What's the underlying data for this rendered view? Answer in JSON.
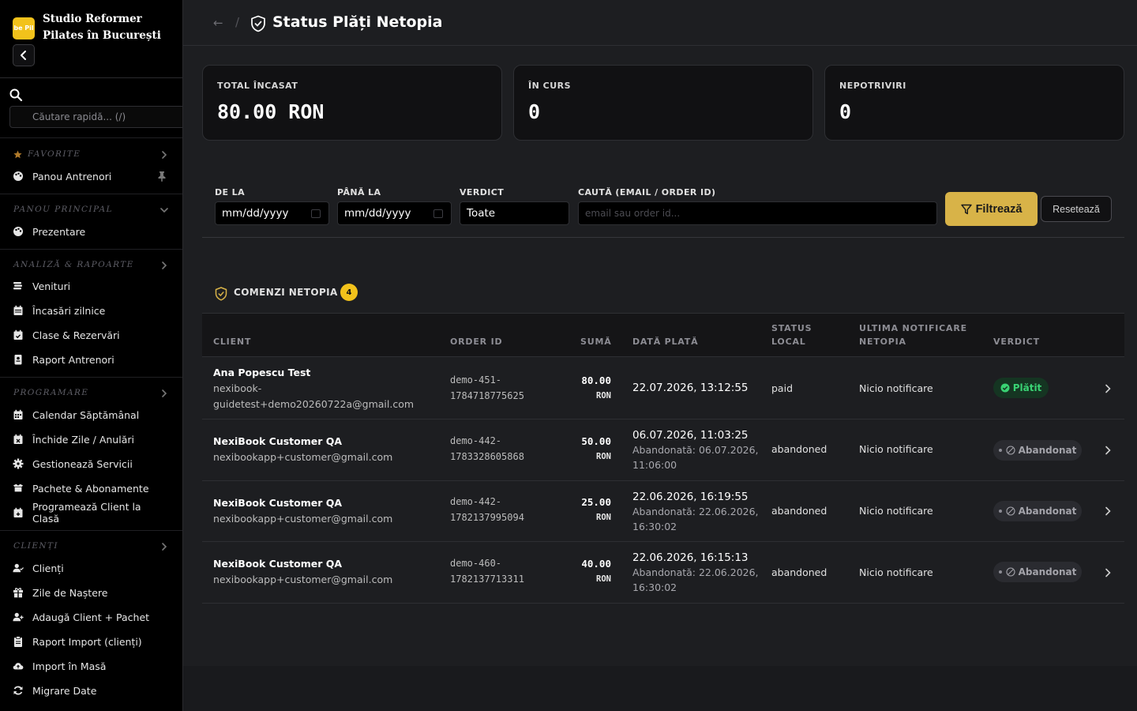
{
  "app": {
    "brand_name": "Studio Reformer Pilates în București",
    "logo_text": "be Pil"
  },
  "sidebar": {
    "search_placeholder": "Căutare rapidă... (/)",
    "sections": {
      "favorite": "FAVORITE",
      "panou_principal": "PANOU PRINCIPAL",
      "analiza": "ANALIZĂ & RAPOARTE",
      "programare": "PROGRAMARE",
      "clienti": "CLIENȚI"
    },
    "items": {
      "panou_antrenori": "Panou Antrenori",
      "prezentare": "Prezentare",
      "venituri": "Venituri",
      "incasari": "Încasări zilnice",
      "clase": "Clase & Rezervări",
      "raport_antrenori": "Raport Antrenori",
      "calendar": "Calendar Săptămânal",
      "inchide_zile": "Închide Zile / Anulări",
      "servicii": "Gestionează Servicii",
      "pachete": "Pachete & Abonamente",
      "programeaza": "Programează Client la Clasă",
      "clienti": "Clienți",
      "zile_nastere": "Zile de Naștere",
      "adauga_client": "Adaugă Client + Pachet",
      "raport_import": "Raport Import (clienți)",
      "import_masa": "Import în Masă",
      "migrare": "Migrare Date"
    }
  },
  "header": {
    "back": "←",
    "separator": "/",
    "title": "Status Plăți Netopia"
  },
  "stats": {
    "total_label": "TOTAL ÎNCASAT",
    "total_value": "80.00 RON",
    "curs_label": "ÎN CURS",
    "curs_value": "0",
    "nepotriviri_label": "NEPOTRIVIRI",
    "nepotriviri_value": "0"
  },
  "filters": {
    "from_label": "DE LA",
    "from_value": "mm/dd/yyyy",
    "to_label": "PÂNĂ LA",
    "to_value": "mm/dd/yyyy",
    "verdict_label": "VERDICT",
    "verdict_value": "Toate",
    "search_label": "CAUTĂ (EMAIL / ORDER ID)",
    "search_placeholder": "email sau order id...",
    "filter_button": "Filtrează",
    "reset_button": "Resetează"
  },
  "orders": {
    "title": "COMENZI NETOPIA",
    "count": "4",
    "columns": {
      "client": "CLIENT",
      "order_id": "ORDER ID",
      "suma": "SUMĂ",
      "data": "DATĂ PLATĂ",
      "status_1": "STATUS",
      "status_2": "LOCAL",
      "notif_1": "ULTIMA NOTIFICARE",
      "notif_2": "NETOPIA",
      "verdict": "VERDICT"
    },
    "rows": [
      {
        "name": "Ana Popescu Test",
        "email": "nexibook-guidetest+demo20260722a@gmail.com",
        "order_id": "demo-451-1784718775625",
        "amount": "80.00",
        "currency": "RON",
        "date": "22.07.2026, 13:12:55",
        "sub": "",
        "status": "paid",
        "notif": "Nicio notificare",
        "verdict": "Plătit"
      },
      {
        "name": "NexiBook Customer QA",
        "email": "nexibookapp+customer@gmail.com",
        "order_id": "demo-442-1783328605868",
        "amount": "50.00",
        "currency": "RON",
        "date": "06.07.2026, 11:03:25",
        "sub": "Abandonată: 06.07.2026, 11:06:00",
        "status": "abandoned",
        "notif": "Nicio notificare",
        "verdict": "Abandonat"
      },
      {
        "name": "NexiBook Customer QA",
        "email": "nexibookapp+customer@gmail.com",
        "order_id": "demo-442-1782137995094",
        "amount": "25.00",
        "currency": "RON",
        "date": "22.06.2026, 16:19:55",
        "sub": "Abandonată: 22.06.2026, 16:30:02",
        "status": "abandoned",
        "notif": "Nicio notificare",
        "verdict": "Abandonat"
      },
      {
        "name": "NexiBook Customer QA",
        "email": "nexibookapp+customer@gmail.com",
        "order_id": "demo-460-1782137713311",
        "amount": "40.00",
        "currency": "RON",
        "date": "22.06.2026, 16:15:13",
        "sub": "Abandonată: 22.06.2026, 16:30:02",
        "status": "abandoned",
        "notif": "Nicio notificare",
        "verdict": "Abandonat"
      }
    ]
  },
  "colors": {
    "accent": "#d8b348",
    "badge_yellow": "#f2c21b",
    "paid_green": "#39d273"
  },
  "icons": [
    "search-icon",
    "star-icon",
    "pin-icon",
    "palette-icon",
    "coins-icon",
    "calendar-icon",
    "gear-icon",
    "box-icon",
    "user-icon",
    "gift-icon",
    "user-plus-icon",
    "clipboard-icon",
    "cloud-upload-icon",
    "refresh-icon",
    "shield-check-icon",
    "filter-icon",
    "chevron-right-icon",
    "check-circle-icon",
    "ban-icon"
  ]
}
